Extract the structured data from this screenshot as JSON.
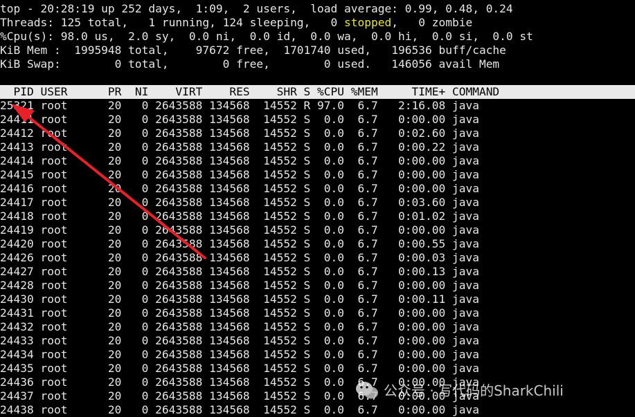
{
  "summary": {
    "line1": "top - 20:28:19 up 252 days,  1:09,  2 users,  load average: 0.99, 0.48, 0.24",
    "line2_prefix": "Threads: 125 total,   1 running, 124 sleeping,   0 ",
    "line2_stopped": "stopped",
    "line2_suffix": ",   0 zombie",
    "line3": "%Cpu(s): 98.0 us,  2.0 sy,  0.0 ni,  0.0 id,  0.0 wa,  0.0 hi,  0.0 si,  0.0 st",
    "line4": "KiB Mem :  1995948 total,    97672 free,  1701740 used,   196536 buff/cache",
    "line5": "KiB Swap:        0 total,        0 free,        0 used.   146056 avail Mem"
  },
  "table": {
    "header": "  PID USER      PR  NI    VIRT    RES    SHR S %CPU %MEM     TIME+ COMMAND",
    "rows": [
      "25321 root      20   0 2643588 134568  14552 R 97.0  6.7   2:16.08 java",
      "24411 root      20   0 2643588 134568  14552 S  0.0  6.7   0:00.00 java",
      "24412 root      20   0 2643588 134568  14552 S  0.0  6.7   0:02.60 java",
      "24413 root      20   0 2643588 134568  14552 S  0.0  6.7   0:00.22 java",
      "24414 root      20   0 2643588 134568  14552 S  0.0  6.7   0:00.00 java",
      "24415 root      20   0 2643588 134568  14552 S  0.0  6.7   0:00.00 java",
      "24416 root      20   0 2643588 134568  14552 S  0.0  6.7   0:00.00 java",
      "24417 root      20   0 2643588 134568  14552 S  0.0  6.7   0:03.60 java",
      "24418 root      20   0 2643588 134568  14552 S  0.0  6.7   0:01.02 java",
      "24419 root      20   0 2643588 134568  14552 S  0.0  6.7   0:00.00 java",
      "24420 root      20   0 2643588 134568  14552 S  0.0  6.7   0:00.55 java",
      "24426 root      20   0 2643588 134568  14552 S  0.0  6.7   0:00.03 java",
      "24427 root      20   0 2643588 134568  14552 S  0.0  6.7   0:00.13 java",
      "24428 root      20   0 2643588 134568  14552 S  0.0  6.7   0:00.00 java",
      "24430 root      20   0 2643588 134568  14552 S  0.0  6.7   0:00.11 java",
      "24431 root      20   0 2643588 134568  14552 S  0.0  6.7   0:00.00 java",
      "24432 root      20   0 2643588 134568  14552 S  0.0  6.7   0:00.00 java",
      "24433 root      20   0 2643588 134568  14552 S  0.0  6.7   0:00.00 java",
      "24434 root      20   0 2643588 134568  14552 S  0.0  6.7   0:00.00 java",
      "24435 root      20   0 2643588 134568  14552 S  0.0  6.7   0:00.00 java",
      "24436 root      20   0 2643588 134568  14552 S  0.0  6.7   0:00.00 java",
      "24437 root      20   0 2643588 134568  14552 S  0.0  6.7   0:00.00 java",
      "24438 root      20   0 2643588 134568  14552 S  0.0  6.7   0:00.00 java"
    ]
  },
  "annotation": {
    "arrow_color": "#e8202a",
    "icon": "red-arrow-icon"
  },
  "watermark": {
    "text": "公众号 · 写代码的SharkChili",
    "icon": "wechat-icon"
  },
  "colors": {
    "background": "#000000",
    "foreground": "#e6e6e6",
    "stopped": "#e8e62c",
    "header_bg": "#e9e9e9"
  }
}
